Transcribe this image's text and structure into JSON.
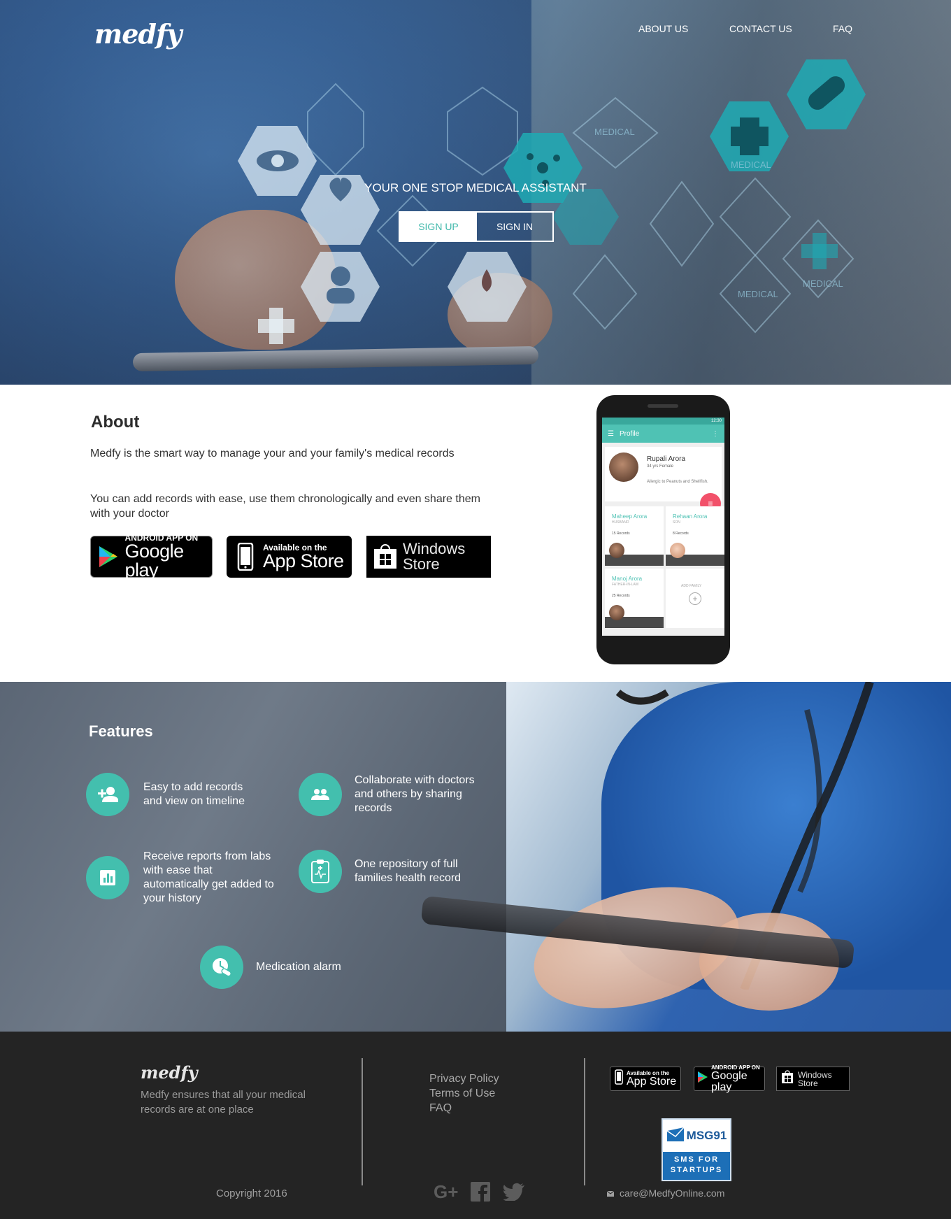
{
  "brand": {
    "logo": "medfy"
  },
  "nav": {
    "items": [
      "ABOUT US",
      "CONTACT US",
      "FAQ"
    ]
  },
  "hero": {
    "tagline": "YOUR ONE STOP MEDICAL ASSISTANT",
    "signup_label": "SIGN UP",
    "signin_label": "SIGN IN",
    "hex_labels": [
      "MEDICAL",
      "MEDICAL",
      "MEDICAL",
      "MEDICAL"
    ]
  },
  "about": {
    "title": "About",
    "paragraphs": [
      "Medfy is the smart way to manage your and your family's medical records",
      "You can add records with ease, use them chronologically and even share them with your doctor"
    ],
    "stores": {
      "google": {
        "small": "ANDROID APP ON",
        "big": "Google play"
      },
      "apple": {
        "small": "Available on the",
        "big": "App Store"
      },
      "windows": {
        "line1": "Windows",
        "line2": "Store"
      }
    }
  },
  "phone": {
    "time": "12:30",
    "bar_title": "Profile",
    "profile": {
      "name": "Rupali Arora",
      "info": "34 yrs   Female",
      "allergy": "Allergic to Peanuts and Shellfish."
    },
    "members": [
      {
        "name": "Maheep Arora",
        "relation": "HUSBAND",
        "records": "15 Records"
      },
      {
        "name": "Rehaan Arora",
        "relation": "SON",
        "records": "8 Records"
      },
      {
        "name": "Manoj Arora",
        "relation": "FATHER-IN-LAW",
        "records": "25 Records"
      }
    ],
    "add_family": "ADD FAMILY"
  },
  "features": {
    "title": "Features",
    "items": [
      {
        "text": "Easy to add records and view on timeline",
        "icon": "add-person-icon"
      },
      {
        "text": "Collaborate with doctors and others by sharing records",
        "icon": "people-icon"
      },
      {
        "text": "Receive reports from labs with ease that automatically get added to your history",
        "icon": "bar-chart-icon"
      },
      {
        "text": "One repository of full families health record",
        "icon": "clipboard-icon"
      },
      {
        "text": "Medication alarm",
        "icon": "pill-clock-icon"
      }
    ]
  },
  "footer": {
    "logo": "medfy",
    "description": "Medfy ensures that all your medical records are at one place",
    "links": [
      "Privacy Policy",
      "Terms of Use",
      "FAQ"
    ],
    "stores": {
      "apple": {
        "small": "Available on the",
        "big": "App Store"
      },
      "google": {
        "small": "ANDROID APP ON",
        "big": "Google play"
      },
      "windows": {
        "line1": "Windows",
        "line2": "Store"
      }
    },
    "msg91": {
      "name": "MSG91",
      "line1": "SMS FOR",
      "line2": "STARTUPS"
    },
    "copyright": "Copyright 2016",
    "social": [
      "google-plus-icon",
      "facebook-icon",
      "twitter-icon"
    ],
    "email": "care@MedfyOnline.com"
  },
  "colors": {
    "accent": "#43bfae",
    "footer_bg": "#242424",
    "fab": "#f2516a"
  }
}
